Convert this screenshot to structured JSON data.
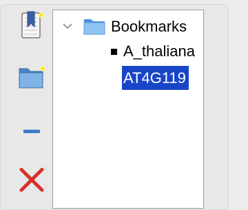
{
  "toolbar": {
    "buttons": [
      {
        "name": "add-bookmark",
        "icon": "bookmark-add-icon"
      },
      {
        "name": "new-folder",
        "icon": "folder-new-icon"
      },
      {
        "name": "remove",
        "icon": "minus-icon"
      },
      {
        "name": "delete",
        "icon": "close-icon"
      }
    ]
  },
  "tree": {
    "root_label": "Bookmarks",
    "child_label": "A_thaliana",
    "selected_label": "AT4G119"
  },
  "colors": {
    "selection_bg": "#1846c8",
    "delete_red": "#d6332a",
    "folder_blue": "#5b9bd8",
    "minus_blue": "#3f79c9"
  }
}
